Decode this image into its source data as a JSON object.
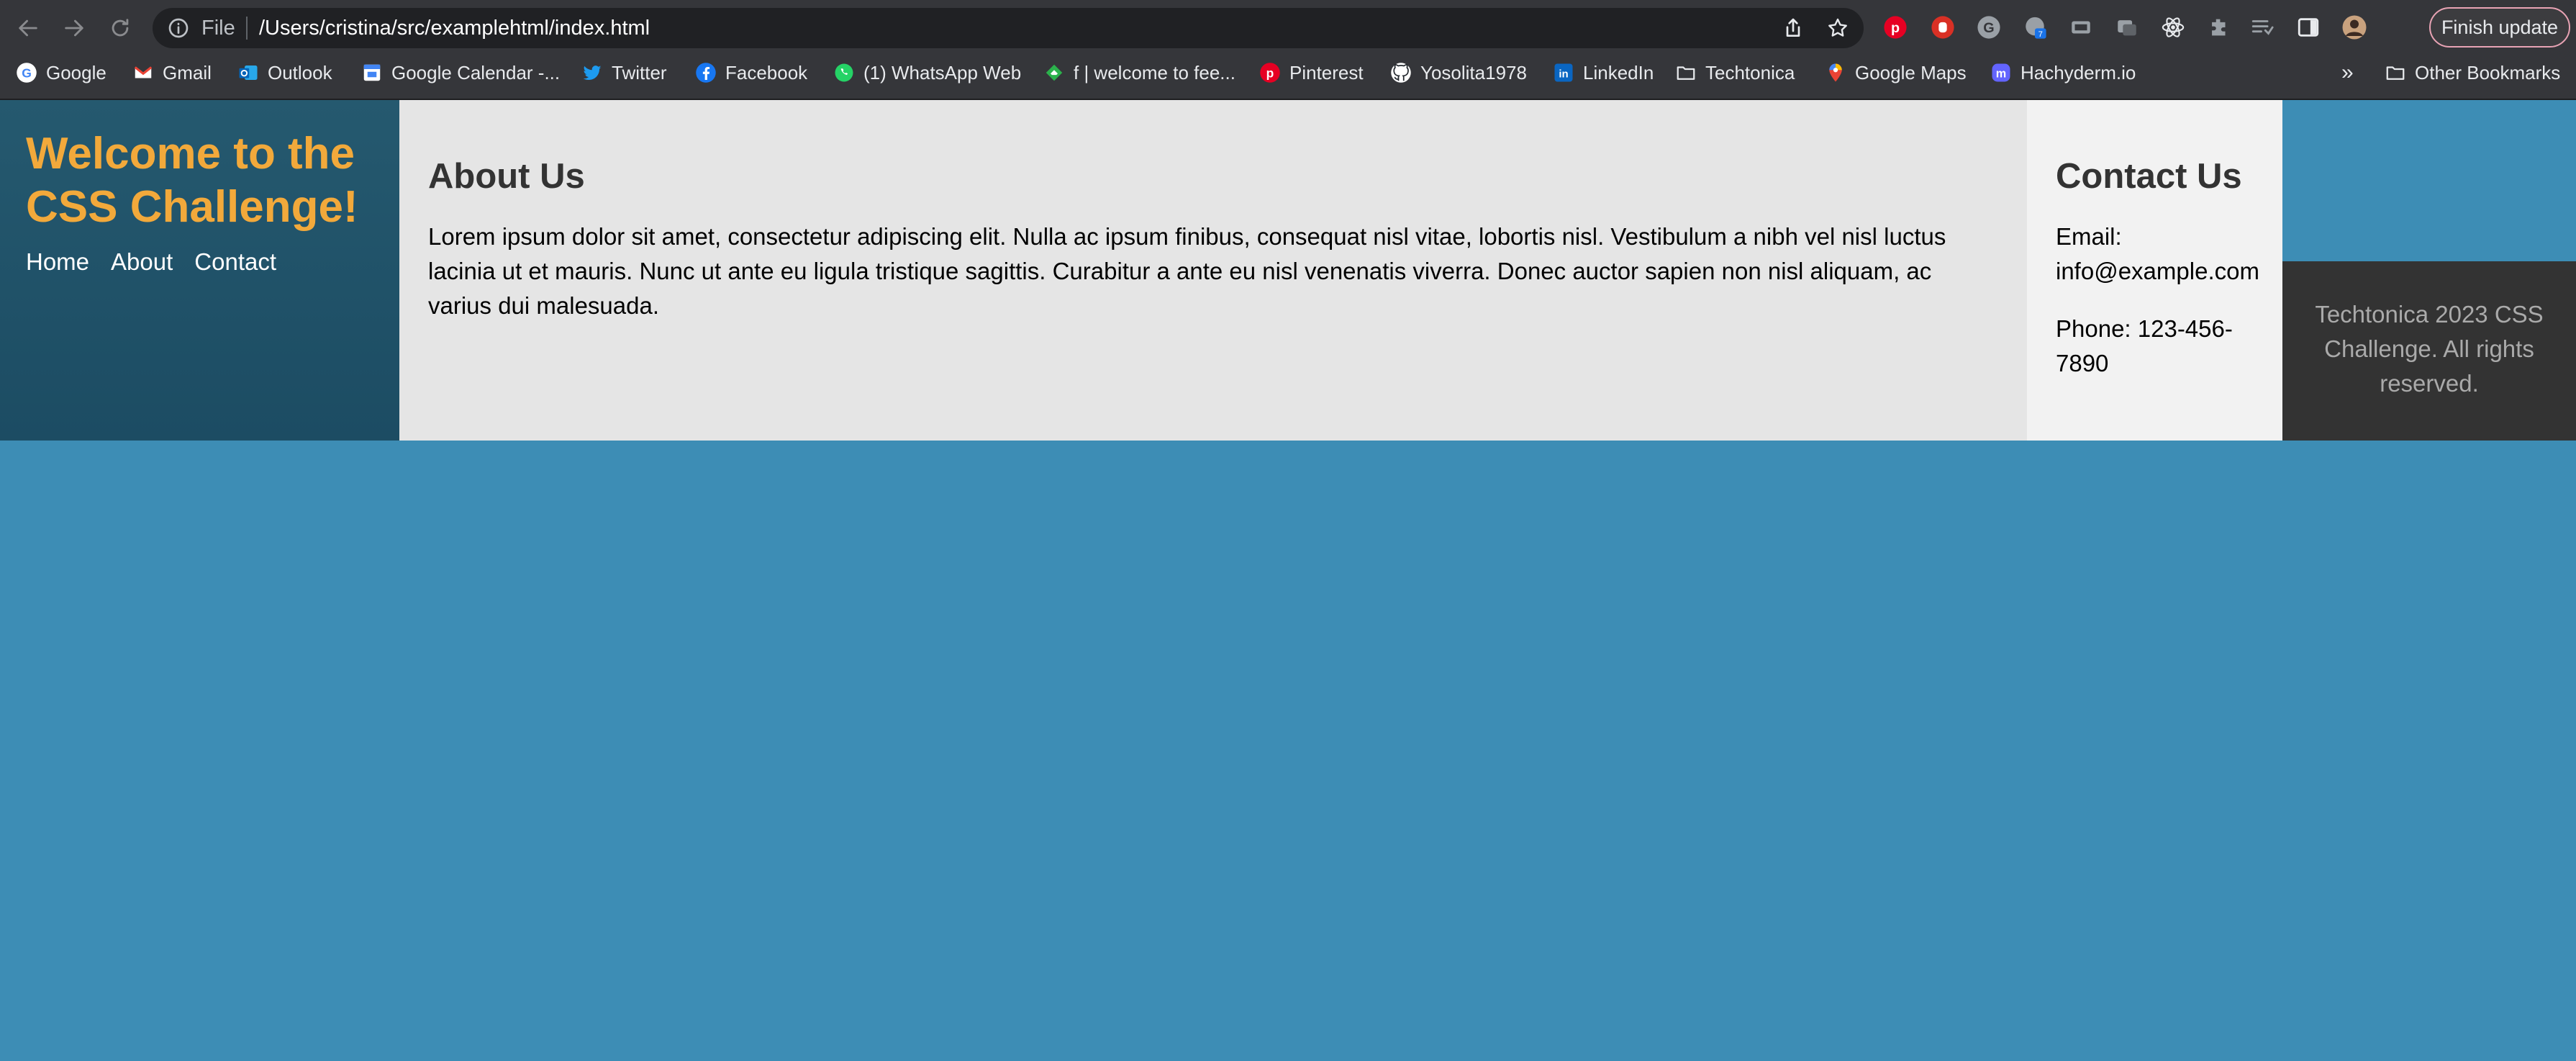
{
  "browser": {
    "address_scheme": "File",
    "address_url": "/Users/cristina/src/examplehtml/index.html",
    "finish_update_label": "Finish update",
    "bookmarks": [
      {
        "label": "Google",
        "icon": "google-icon"
      },
      {
        "label": "Gmail",
        "icon": "gmail-icon"
      },
      {
        "label": "Outlook",
        "icon": "outlook-icon"
      },
      {
        "label": "Google Calendar -...",
        "icon": "calendar-icon"
      },
      {
        "label": "Twitter",
        "icon": "twitter-icon"
      },
      {
        "label": "Facebook",
        "icon": "facebook-icon"
      },
      {
        "label": "(1) WhatsApp Web",
        "icon": "whatsapp-icon"
      },
      {
        "label": "f | welcome to fee...",
        "icon": "feedly-icon"
      },
      {
        "label": "Pinterest",
        "icon": "pinterest-icon"
      },
      {
        "label": "Yosolita1978",
        "icon": "github-icon"
      },
      {
        "label": "LinkedIn",
        "icon": "linkedin-icon"
      },
      {
        "label": "Techtonica",
        "icon": "folder-icon"
      },
      {
        "label": "Google Maps",
        "icon": "maps-icon"
      },
      {
        "label": "Hachyderm.io",
        "icon": "mastodon-icon"
      }
    ],
    "overflow_label": "»",
    "other_bookmarks_label": "Other Bookmarks",
    "extension_badge": "7"
  },
  "page": {
    "header": {
      "title": "Welcome to the CSS Challenge!",
      "nav": [
        "Home",
        "About",
        "Contact"
      ]
    },
    "about": {
      "heading": "About Us",
      "body": "Lorem ipsum dolor sit amet, consectetur adipiscing elit. Nulla ac ipsum finibus, consequat nisl vitae, lobortis nisl. Vestibulum a nibh vel nisl luctus lacinia ut et mauris. Nunc ut ante eu ligula tristique sagittis. Curabitur a ante eu nisl venenatis viverra. Donec auctor sapien non nisl aliquam, ac varius dui malesuada."
    },
    "contact": {
      "heading": "Contact Us",
      "email": "Email: info@example.com",
      "phone": "Phone: 123-456-7890"
    },
    "footer": {
      "text": "Techtonica 2023 CSS Challenge. All rights reserved."
    }
  },
  "colors": {
    "page_background": "#3d8db5",
    "header_background": "#1f5066",
    "title_color": "#f2a93b",
    "about_background": "#e5e5e5",
    "contact_background": "#f2f2f2",
    "footer_background": "#333333"
  }
}
